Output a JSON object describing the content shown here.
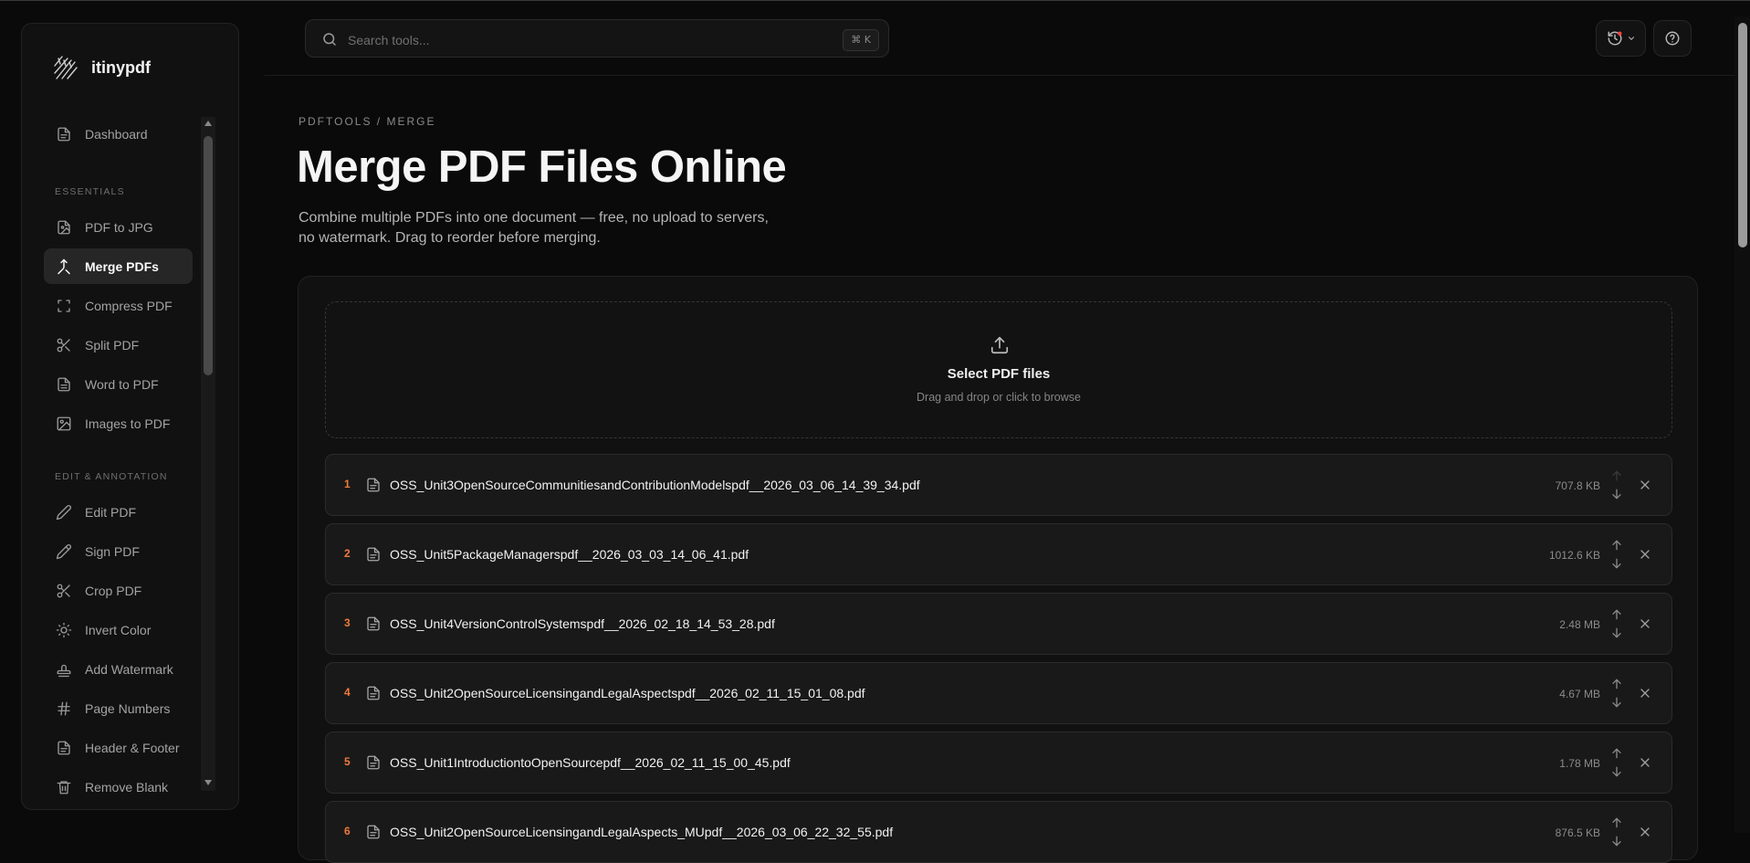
{
  "app": {
    "name": "itinypdf"
  },
  "sidebar": {
    "dashboard": "Dashboard",
    "sections": [
      {
        "title": "ESSENTIALS"
      },
      {
        "title": "EDIT & ANNOTATION"
      }
    ],
    "items": [
      {
        "label": "PDF to JPG",
        "icon": "file-image-icon"
      },
      {
        "label": "Merge PDFs",
        "icon": "merge-icon",
        "active": true
      },
      {
        "label": "Compress PDF",
        "icon": "compress-icon"
      },
      {
        "label": "Split PDF",
        "icon": "scissors-icon"
      },
      {
        "label": "Word to PDF",
        "icon": "file-text-icon"
      },
      {
        "label": "Images to PDF",
        "icon": "image-icon"
      },
      {
        "label": "Edit PDF",
        "icon": "pencil-icon"
      },
      {
        "label": "Sign PDF",
        "icon": "pen-icon"
      },
      {
        "label": "Crop PDF",
        "icon": "crop-icon"
      },
      {
        "label": "Invert Color",
        "icon": "sun-icon"
      },
      {
        "label": "Add Watermark",
        "icon": "stamp-icon"
      },
      {
        "label": "Page Numbers",
        "icon": "hash-icon"
      },
      {
        "label": "Header & Footer",
        "icon": "file-header-icon"
      },
      {
        "label": "Remove Blank",
        "icon": "trash-icon"
      }
    ]
  },
  "search": {
    "placeholder": "Search tools...",
    "shortcut": "⌘ K"
  },
  "header": {
    "breadcrumb": "PDFTOOLS / MERGE"
  },
  "main": {
    "title": "Merge PDF Files Online",
    "subtitle": "Combine multiple PDFs into one document — free, no upload to servers, no watermark. Drag to reorder before merging."
  },
  "dropzone": {
    "title": "Select PDF files",
    "hint": "Drag and drop or click to browse"
  },
  "files": [
    {
      "index": "1",
      "name": "OSS_Unit3OpenSourceCommunitiesandContributionModelspdf__2026_03_06_14_39_34.pdf",
      "size": "707.8 KB"
    },
    {
      "index": "2",
      "name": "OSS_Unit5PackageManagerspdf__2026_03_03_14_06_41.pdf",
      "size": "1012.6 KB"
    },
    {
      "index": "3",
      "name": "OSS_Unit4VersionControlSystemspdf__2026_02_18_14_53_28.pdf",
      "size": "2.48 MB"
    },
    {
      "index": "4",
      "name": "OSS_Unit2OpenSourceLicensingandLegalAspectspdf__2026_02_11_15_01_08.pdf",
      "size": "4.67 MB"
    },
    {
      "index": "5",
      "name": "OSS_Unit1IntroductiontoOpenSourcepdf__2026_02_11_15_00_45.pdf",
      "size": "1.78 MB"
    },
    {
      "index": "6",
      "name": "OSS_Unit2OpenSourceLicensingandLegalAspects_MUpdf__2026_03_06_22_32_55.pdf",
      "size": "876.5 KB"
    }
  ],
  "colors": {
    "accent": "#f07a3a",
    "background": "#0a0a0a",
    "panel": "#111111",
    "notification": "#ef4444"
  }
}
